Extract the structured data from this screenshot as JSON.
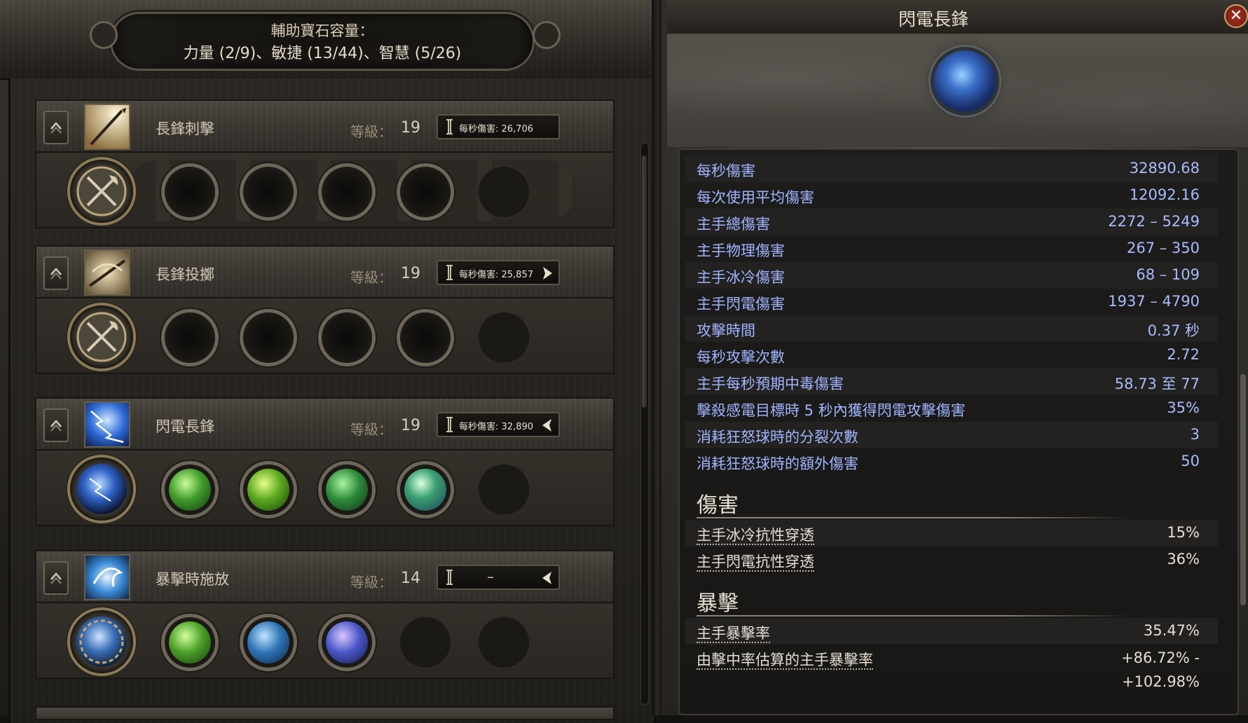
{
  "header": {
    "title": "輔助寶石容量：",
    "capacity_line": "力量 (2/9)、敏捷 (13/44)、智慧 (5/26)"
  },
  "skills": [
    {
      "name": "長鋒刺擊",
      "level_label": "等級：",
      "level": "19",
      "dps": "每秒傷害: 26,706",
      "arrow": "right",
      "icon": "spear-thrust-icon",
      "weapon_slot_icon": "crossed-axes-icon",
      "gems": [
        "empty",
        "empty",
        "empty",
        "empty"
      ]
    },
    {
      "name": "長鋒投擲",
      "level_label": "等級：",
      "level": "19",
      "dps": "每秒傷害: 25,857",
      "arrow": "right",
      "icon": "spear-throw-icon",
      "weapon_slot_icon": "crossed-axes-icon",
      "gems": [
        "empty",
        "empty",
        "empty",
        "empty"
      ]
    },
    {
      "name": "閃電長鋒",
      "level_label": "等級：",
      "level": "19",
      "dps": "每秒傷害: 32,890",
      "arrow": "left",
      "icon": "lightning-spear-icon",
      "weapon_slot_icon": "lightning-orb-icon",
      "gems": [
        "green-gem",
        "green-gem",
        "green-gem",
        "green-blue-gem"
      ]
    },
    {
      "name": "暴擊時施放",
      "level_label": "等級：",
      "level": "14",
      "dps": "–",
      "arrow": "left",
      "icon": "cast-on-crit-icon",
      "weapon_slot_icon": "chain-orb-icon",
      "gems": [
        "green-gem",
        "blue-gem",
        "purple-blue-gem"
      ]
    }
  ],
  "detail": {
    "title": "閃電長鋒",
    "close_label": "✕",
    "stats": [
      {
        "label": "每秒傷害",
        "value": "32890.68"
      },
      {
        "label": "每次使用平均傷害",
        "value": "12092.16"
      },
      {
        "label": "主手總傷害",
        "value": "2272 – 5249"
      },
      {
        "label": "主手物理傷害",
        "value": "267 – 350"
      },
      {
        "label": "主手冰冷傷害",
        "value": "68 – 109"
      },
      {
        "label": "主手閃電傷害",
        "value": "1937 – 4790"
      },
      {
        "label": "攻擊時間",
        "value": "0.37 秒"
      },
      {
        "label": "每秒攻擊次數",
        "value": "2.72"
      },
      {
        "label": "主手每秒預期中毒傷害",
        "value": "58.73 至 77"
      },
      {
        "label": "擊殺感電目標時 5 秒內獲得閃電攻擊傷害",
        "value": "35%"
      },
      {
        "label": "消耗狂怒球時的分裂次數",
        "value": "3"
      },
      {
        "label": "消耗狂怒球時的額外傷害",
        "value": "50"
      }
    ],
    "damage_section": {
      "title": "傷害",
      "stats": [
        {
          "label": "主手冰冷抗性穿透",
          "value": "15%"
        },
        {
          "label": "主手閃電抗性穿透",
          "value": "36%"
        }
      ]
    },
    "crit_section": {
      "title": "暴擊",
      "stats": [
        {
          "label": "主手暴擊率",
          "value": "35.47%"
        },
        {
          "label": "由擊中率估算的主手暴擊率",
          "value": "+86.72% -",
          "value2": "+102.98%"
        }
      ]
    }
  },
  "colors": {
    "stat_blue": "#9fb4ff",
    "stat_plain": "#e6dfd2",
    "gold_text": "#d2c8b4",
    "close_red": "#a8311f"
  }
}
